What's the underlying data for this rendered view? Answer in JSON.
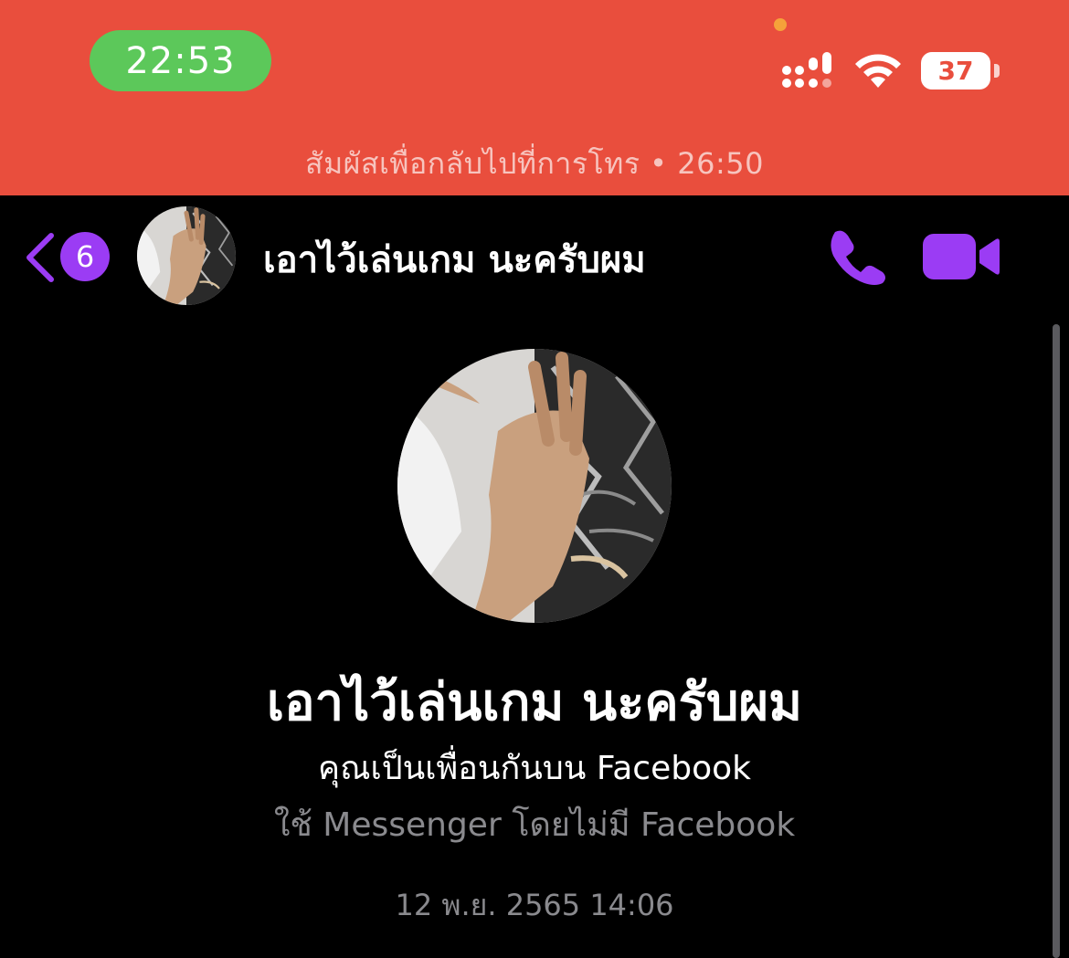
{
  "status_bar": {
    "time": "22:53",
    "battery_level": "37",
    "signal_icon": "cellular-signal-icon",
    "wifi_icon": "wifi-icon"
  },
  "call_banner": {
    "text": "สัมผัสเพื่อกลับไปที่การโทร • 26:50",
    "color": "#e94e3d"
  },
  "header": {
    "back_badge_count": "6",
    "contact_name": "เอาไว้เล่นเกม นะครับผม",
    "accent_color": "#9b3cf4",
    "call_icon": "phone-icon",
    "video_icon": "video-camera-icon"
  },
  "profile": {
    "name": "เอาไว้เล่นเกม นะครับผม",
    "friends_text": "คุณเป็นเพื่อนกันบน Facebook",
    "messenger_text": "ใช้ Messenger โดยไม่มี Facebook"
  },
  "conversation": {
    "first_timestamp": "12 พ.ย. 2565 14:06"
  }
}
